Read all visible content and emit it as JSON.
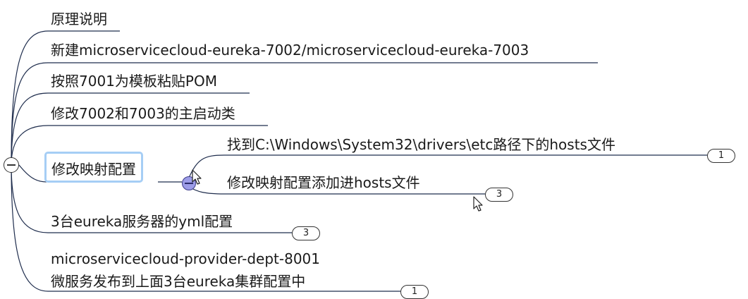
{
  "nodes": {
    "principle": "原理说明",
    "new_modules": "新建microservicecloud-eureka-7002/microservicecloud-eureka-7003",
    "paste_pom": "按照7001为模板粘贴POM",
    "main_class": "修改7002和7003的主启动类",
    "mapping": "修改映射配置",
    "find_hosts": "找到C:\\Windows\\System32\\drivers\\etc路径下的hosts文件",
    "add_hosts": "修改映射配置添加进hosts文件",
    "yml_config": "3台eureka服务器的yml配置",
    "provider": "microservicecloud-provider-dept-8001\n微服务发布到上面3台eureka集群配置中"
  },
  "badges": {
    "find_hosts": "1",
    "add_hosts": "3",
    "yml_config": "3",
    "provider": "1"
  },
  "colors": {
    "line": "#1f2d4d",
    "selected_border": "#a6cef5",
    "expand_fill": "#9d9de8"
  },
  "icons": {
    "collapse": "minus-circle-icon",
    "expand": "minus-circle-icon",
    "cursor": "mouse-pointer-icon"
  }
}
